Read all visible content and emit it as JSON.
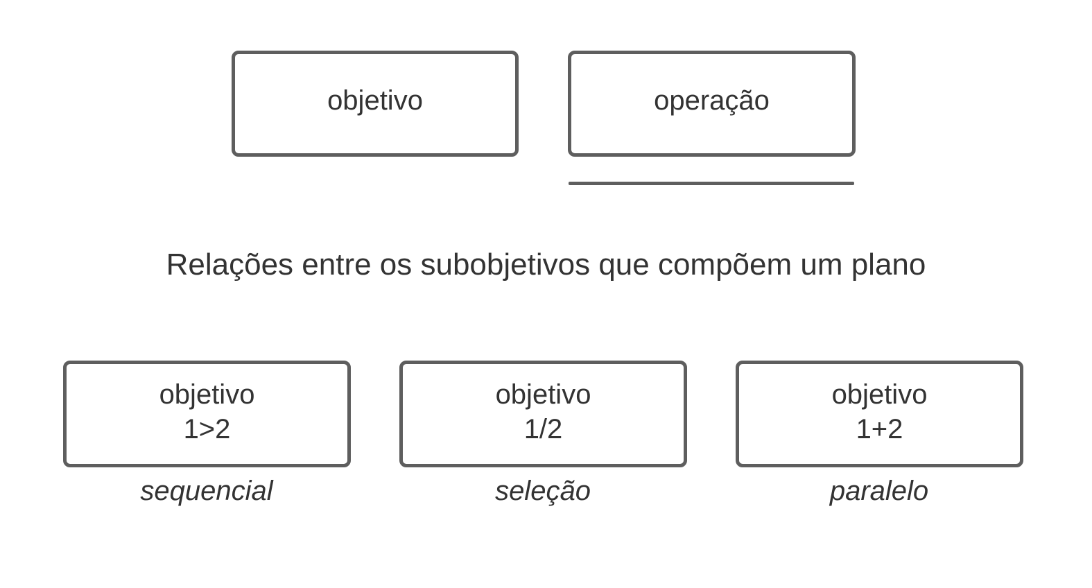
{
  "top": {
    "goal_box": {
      "label": "objetivo"
    },
    "operation_box": {
      "label": "operação"
    }
  },
  "title": "Relações entre os subobjetivos que compõem um plano",
  "relations": [
    {
      "label": "objetivo",
      "expression": "1>2",
      "caption": "sequencial"
    },
    {
      "label": "objetivo",
      "expression": "1/2",
      "caption": "seleção"
    },
    {
      "label": "objetivo",
      "expression": "1+2",
      "caption": "paralelo"
    }
  ],
  "colors": {
    "stroke": "#5e5e5e",
    "text": "#333333",
    "background": "#ffffff"
  }
}
